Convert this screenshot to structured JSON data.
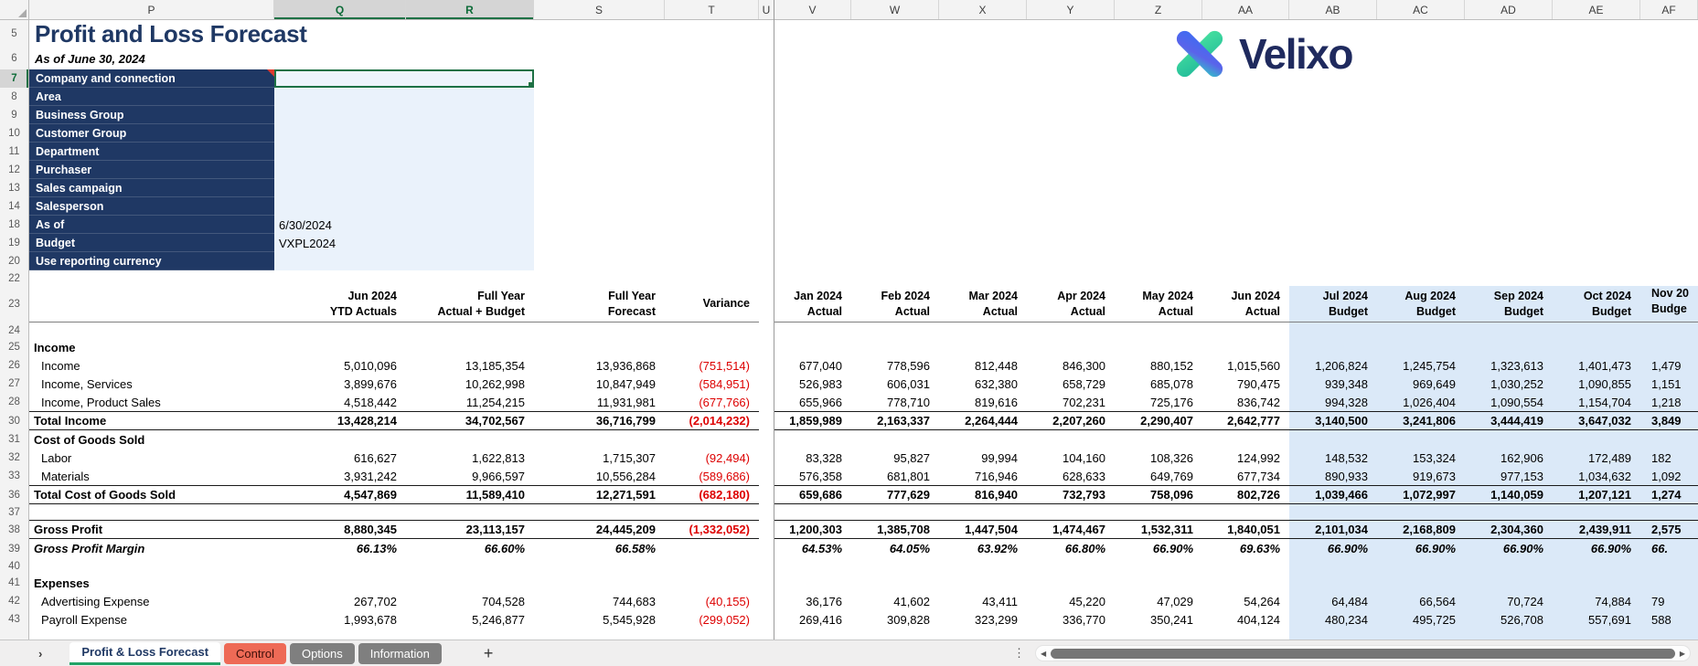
{
  "report": {
    "title": "Profit and Loss Forecast",
    "subtitle": "As of June 30, 2024",
    "logo_text": "Velixo"
  },
  "columns": {
    "letters": [
      "P",
      "Q",
      "R",
      "S",
      "T",
      "U",
      "V",
      "W",
      "X",
      "Y",
      "Z",
      "AA",
      "AB",
      "AC",
      "AD",
      "AE",
      "AF"
    ],
    "selected": [
      "Q",
      "R"
    ]
  },
  "filters": [
    {
      "row": "7",
      "label": "Company and connection",
      "value": "",
      "note": true,
      "selected": true,
      "dropdown": true
    },
    {
      "row": "8",
      "label": "Area",
      "value": ""
    },
    {
      "row": "9",
      "label": "Business Group",
      "value": ""
    },
    {
      "row": "10",
      "label": "Customer Group",
      "value": ""
    },
    {
      "row": "11",
      "label": "Department",
      "value": ""
    },
    {
      "row": "12",
      "label": "Purchaser",
      "value": ""
    },
    {
      "row": "13",
      "label": "Sales campaign",
      "value": ""
    },
    {
      "row": "14",
      "label": "Salesperson",
      "value": ""
    },
    {
      "row": "18",
      "label": "As of",
      "value": "6/30/2024"
    },
    {
      "row": "19",
      "label": "Budget",
      "value": "VXPL2024"
    },
    {
      "row": "20",
      "label": "Use reporting currency",
      "value": ""
    }
  ],
  "table": {
    "rows": [
      {
        "num": "22",
        "type": "spacer",
        "blue": false
      },
      {
        "num": "23",
        "type": "colheads",
        "summary": [
          [
            "Jun 2024",
            "YTD Actuals"
          ],
          [
            "Full Year",
            "Actual + Budget"
          ],
          [
            "Full Year",
            "Forecast"
          ],
          [
            "",
            "Variance"
          ]
        ],
        "months": [
          [
            "Jan 2024",
            "Actual"
          ],
          [
            "Feb 2024",
            "Actual"
          ],
          [
            "Mar 2024",
            "Actual"
          ],
          [
            "Apr 2024",
            "Actual"
          ],
          [
            "May 2024",
            "Actual"
          ],
          [
            "Jun 2024",
            "Actual"
          ],
          [
            "Jul 2024",
            "Budget"
          ],
          [
            "Aug 2024",
            "Budget"
          ],
          [
            "Sep 2024",
            "Budget"
          ],
          [
            "Oct 2024",
            "Budget"
          ]
        ],
        "af": [
          "Nov 20",
          "Budge"
        ]
      },
      {
        "num": "24",
        "type": "spacer",
        "blue": true
      },
      {
        "num": "25",
        "type": "section",
        "label": "Income"
      },
      {
        "num": "26",
        "type": "data",
        "label": "Income",
        "summary": [
          "5,010,096",
          "13,185,354",
          "13,936,868",
          "(751,514)"
        ],
        "months": [
          "677,040",
          "778,596",
          "812,448",
          "846,300",
          "880,152",
          "1,015,560",
          "1,206,824",
          "1,245,754",
          "1,323,613",
          "1,401,473"
        ],
        "af": "1,479"
      },
      {
        "num": "27",
        "type": "data",
        "label": "Income, Services",
        "summary": [
          "3,899,676",
          "10,262,998",
          "10,847,949",
          "(584,951)"
        ],
        "months": [
          "526,983",
          "606,031",
          "632,380",
          "658,729",
          "685,078",
          "790,475",
          "939,348",
          "969,649",
          "1,030,252",
          "1,090,855"
        ],
        "af": "1,151"
      },
      {
        "num": "28",
        "type": "data",
        "label": "Income, Product Sales",
        "summary": [
          "4,518,442",
          "11,254,215",
          "11,931,981",
          "(677,766)"
        ],
        "months": [
          "655,966",
          "778,710",
          "819,616",
          "702,231",
          "725,176",
          "836,742",
          "994,328",
          "1,026,404",
          "1,090,554",
          "1,154,704"
        ],
        "af": "1,218"
      },
      {
        "num": "30",
        "type": "total",
        "label": "Total Income",
        "summary": [
          "13,428,214",
          "34,702,567",
          "36,716,799",
          "(2,014,232)"
        ],
        "months": [
          "1,859,989",
          "2,163,337",
          "2,264,444",
          "2,207,260",
          "2,290,407",
          "2,642,777",
          "3,140,500",
          "3,241,806",
          "3,444,419",
          "3,647,032"
        ],
        "af": "3,849"
      },
      {
        "num": "31",
        "type": "section",
        "label": "Cost of Goods Sold"
      },
      {
        "num": "32",
        "type": "data",
        "label": "Labor",
        "summary": [
          "616,627",
          "1,622,813",
          "1,715,307",
          "(92,494)"
        ],
        "months": [
          "83,328",
          "95,827",
          "99,994",
          "104,160",
          "108,326",
          "124,992",
          "148,532",
          "153,324",
          "162,906",
          "172,489"
        ],
        "af": "182"
      },
      {
        "num": "33",
        "type": "data",
        "label": "Materials",
        "summary": [
          "3,931,242",
          "9,966,597",
          "10,556,284",
          "(589,686)"
        ],
        "months": [
          "576,358",
          "681,801",
          "716,946",
          "628,633",
          "649,769",
          "677,734",
          "890,933",
          "919,673",
          "977,153",
          "1,034,632"
        ],
        "af": "1,092"
      },
      {
        "num": "36",
        "type": "total",
        "label": "Total Cost of Goods Sold",
        "summary": [
          "4,547,869",
          "11,589,410",
          "12,271,591",
          "(682,180)"
        ],
        "months": [
          "659,686",
          "777,629",
          "816,940",
          "732,793",
          "758,096",
          "802,726",
          "1,039,466",
          "1,072,997",
          "1,140,059",
          "1,207,121"
        ],
        "af": "1,274"
      },
      {
        "num": "37",
        "type": "spacer",
        "blue": true
      },
      {
        "num": "38",
        "type": "total",
        "label": "Gross Profit",
        "summary": [
          "8,880,345",
          "23,113,157",
          "24,445,209",
          "(1,332,052)"
        ],
        "months": [
          "1,200,303",
          "1,385,708",
          "1,447,504",
          "1,474,467",
          "1,532,311",
          "1,840,051",
          "2,101,034",
          "2,168,809",
          "2,304,360",
          "2,439,911"
        ],
        "af": "2,575"
      },
      {
        "num": "39",
        "type": "margin",
        "label": "Gross Profit Margin",
        "summary": [
          "66.13%",
          "66.60%",
          "66.58%",
          ""
        ],
        "months": [
          "64.53%",
          "64.05%",
          "63.92%",
          "66.80%",
          "66.90%",
          "69.63%",
          "66.90%",
          "66.90%",
          "66.90%",
          "66.90%"
        ],
        "af": "66."
      },
      {
        "num": "40",
        "type": "spacer",
        "blue": true
      },
      {
        "num": "41",
        "type": "section",
        "label": "Expenses"
      },
      {
        "num": "42",
        "type": "data",
        "label": "Advertising Expense",
        "summary": [
          "267,702",
          "704,528",
          "744,683",
          "(40,155)"
        ],
        "months": [
          "36,176",
          "41,602",
          "43,411",
          "45,220",
          "47,029",
          "54,264",
          "64,484",
          "66,564",
          "70,724",
          "74,884"
        ],
        "af": "79"
      },
      {
        "num": "43",
        "type": "data",
        "label": "Payroll Expense",
        "summary": [
          "1,993,678",
          "5,246,877",
          "5,545,928",
          "(299,052)"
        ],
        "months": [
          "269,416",
          "309,828",
          "323,299",
          "336,770",
          "350,241",
          "404,124",
          "480,234",
          "495,725",
          "526,708",
          "557,691"
        ],
        "af": "588"
      },
      {
        "num": "",
        "type": "filler",
        "blue": true
      }
    ]
  },
  "tabs": {
    "sheets": [
      {
        "label": "Profit & Loss Forecast",
        "state": "active"
      },
      {
        "label": "Control",
        "state": "red"
      },
      {
        "label": "Options",
        "state": "gray"
      },
      {
        "label": "Information",
        "state": "gray"
      }
    ]
  },
  "icons": {
    "tab_nav": "›",
    "add_sheet": "+",
    "scroll_left": "◀",
    "scroll_right": "▶",
    "kebab": "⋮",
    "combo_arrow": "▼"
  },
  "colors": {
    "navy": "#1F3864",
    "filter_fill": "#EAF2FB",
    "budget_fill": "#DBE9F8",
    "negative": "#DD0000",
    "selection_green": "#1E7145",
    "active_tab_underline": "#21A366",
    "control_tab": "#EE6A56",
    "gray_tab": "#7F7F7F"
  }
}
